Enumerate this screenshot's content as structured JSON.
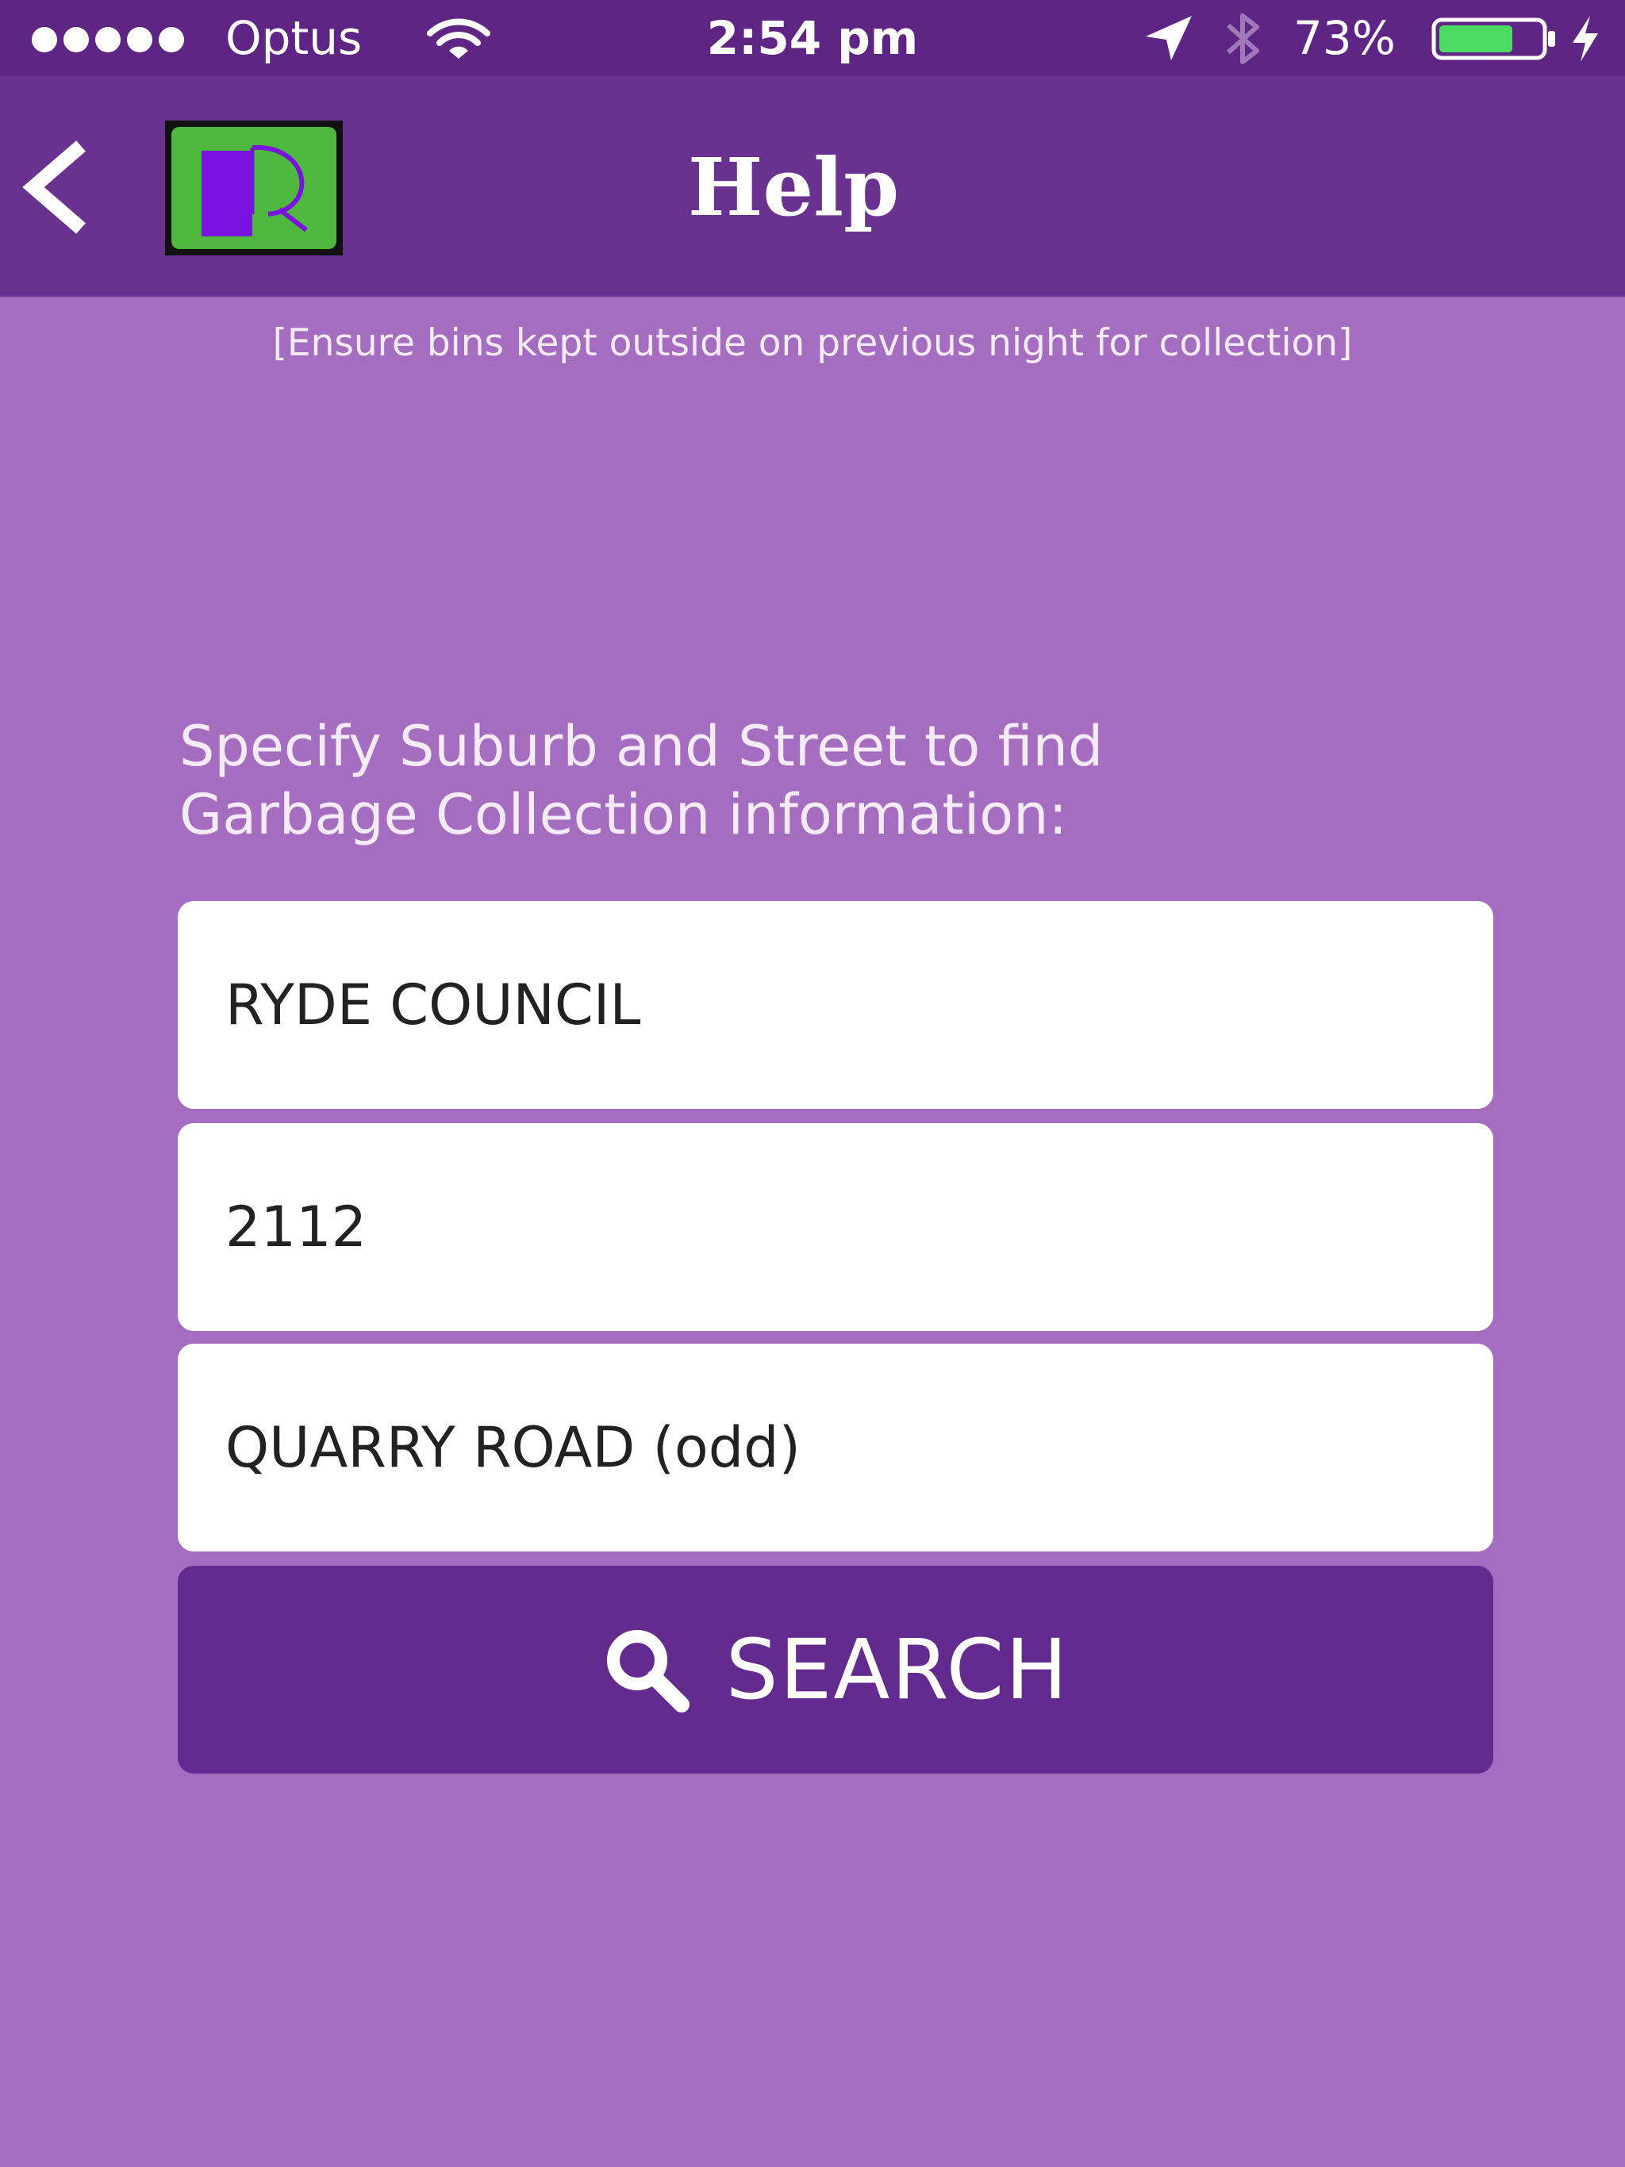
{
  "status_bar": {
    "carrier": "Optus",
    "time": "2:54 pm",
    "battery_percent": "73%",
    "battery_level": 0.73,
    "battery_color": "#4cd964"
  },
  "nav": {
    "title": "Help",
    "back_icon": "chevron-left-icon",
    "logo_icon": "app-logo"
  },
  "notice": "[Ensure bins kept outside on previous night for collection]",
  "instructions": "Specify Suburb and Street to find\nGarbage Collection information:",
  "fields": {
    "council": "RYDE COUNCIL",
    "postcode": "2112",
    "street": "QUARRY ROAD (odd)"
  },
  "search_button": {
    "label": "SEARCH",
    "icon": "search-icon"
  },
  "colors": {
    "background": "#a56dbf",
    "status_bar": "#5e2585",
    "nav_bar": "#6a3290",
    "button": "#632a8f",
    "logo_green": "#4fb83e",
    "logo_purple": "#7a12e0"
  }
}
